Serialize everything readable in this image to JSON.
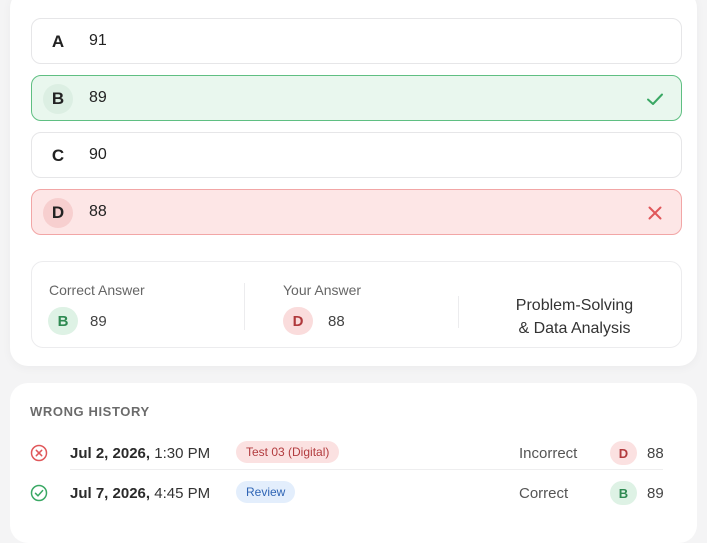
{
  "options": [
    {
      "letter": "A",
      "value": "91",
      "state": "neutral"
    },
    {
      "letter": "B",
      "value": "89",
      "state": "correct"
    },
    {
      "letter": "C",
      "value": "90",
      "state": "neutral"
    },
    {
      "letter": "D",
      "value": "88",
      "state": "wrong"
    }
  ],
  "summary": {
    "correct_label": "Correct Answer",
    "correct_letter": "B",
    "correct_value": "89",
    "your_label": "Your Answer",
    "your_letter": "D",
    "your_value": "88",
    "category_line1": "Problem-Solving",
    "category_line2": "& Data Analysis"
  },
  "history": {
    "title": "WRONG HISTORY",
    "rows": [
      {
        "date": "Jul 2, 2026,",
        "time": "1:30 PM",
        "tag": "Test 03 (Digital)",
        "status": "Incorrect",
        "letter": "D",
        "value": "88"
      },
      {
        "date": "Jul 7, 2026,",
        "time": "4:45 PM",
        "tag": "Review",
        "status": "Correct",
        "letter": "B",
        "value": "89"
      }
    ]
  },
  "colors": {
    "correct": "#3aa864",
    "wrong": "#e0575a",
    "review": "#2f65b5"
  }
}
